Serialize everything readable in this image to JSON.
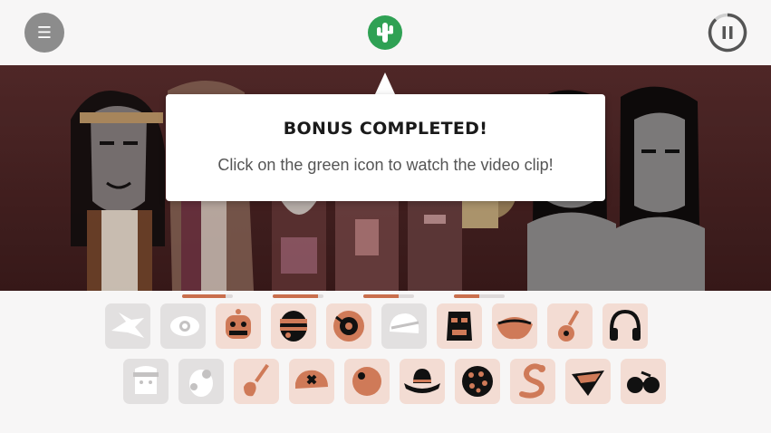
{
  "topbar": {
    "menu_icon": "hamburger-icon",
    "menu_glyph": "☰",
    "center_icon": "cactus-icon",
    "pause_icon": "pause-icon"
  },
  "popup": {
    "title": "BONUS COMPLETED!",
    "message": "Click on the green icon to watch the video clip!"
  },
  "colors": {
    "accent_green": "#2fa154",
    "icon_orange": "#cf7a58",
    "icon_grey": "#c4c2c2",
    "slot_active_bg": "#f3dcd3",
    "slot_inactive_bg": "#e2e0e0"
  },
  "progress_bars": [
    {
      "slot": "row1-3",
      "fraction": 0.85
    },
    {
      "slot": "row1-5",
      "fraction": 0.9
    },
    {
      "slot": "row1-7",
      "fraction": 0.7
    },
    {
      "slot": "row1-9",
      "fraction": 0.5
    }
  ],
  "sound_icons": {
    "row1": [
      {
        "name": "wing-icon",
        "active": false
      },
      {
        "name": "eye-icon",
        "active": false
      },
      {
        "name": "robot-head-icon",
        "active": true
      },
      {
        "name": "masked-head-icon",
        "active": true
      },
      {
        "name": "vinyl-record-icon",
        "active": true
      },
      {
        "name": "helmet-icon",
        "active": false
      },
      {
        "name": "tiki-mask-icon",
        "active": true
      },
      {
        "name": "lips-icon",
        "active": true
      },
      {
        "name": "guitar-icon",
        "active": true
      },
      {
        "name": "headphones-icon",
        "active": true
      }
    ],
    "row2": [
      {
        "name": "bandana-face-icon",
        "active": false
      },
      {
        "name": "egg-icon",
        "active": false
      },
      {
        "name": "electric-guitar-icon",
        "active": true
      },
      {
        "name": "cap-icon",
        "active": true
      },
      {
        "name": "orb-icon",
        "active": true
      },
      {
        "name": "cowboy-hat-icon",
        "active": true
      },
      {
        "name": "cookie-icon",
        "active": true
      },
      {
        "name": "snake-icon",
        "active": true
      },
      {
        "name": "bandana-icon",
        "active": true
      },
      {
        "name": "sunglasses-icon",
        "active": true
      }
    ]
  }
}
